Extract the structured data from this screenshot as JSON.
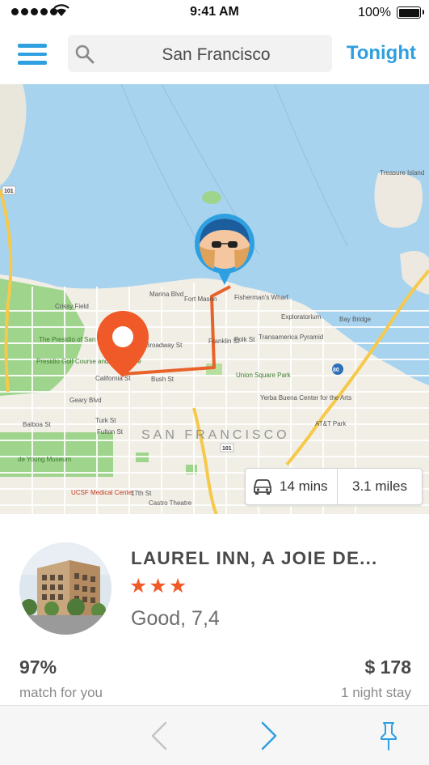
{
  "status_bar": {
    "time": "9:41 AM",
    "battery": "100%"
  },
  "topbar": {
    "search_value": "San Francisco",
    "tonight_label": "Tonight"
  },
  "map": {
    "city_label": "SAN FRANCISCO",
    "labels": [
      "Crissy Field",
      "The Presidio of San Francisco",
      "Presidio Golf Course and Clubhouse",
      "Marina Blvd",
      "Fort Mason",
      "Broadway St",
      "Franklin St",
      "Polk St",
      "California St",
      "Bush St",
      "Geary Blvd",
      "Turk St",
      "Fulton St",
      "Balboa St",
      "de Young Museum",
      "UCSF Medical Center",
      "17th St",
      "Castro Theatre",
      "Union Square Park",
      "Yerba Buena Center for the Arts",
      "Transamerica Pyramid",
      "Fisherman's Wharf",
      "Exploratorium",
      "Bay Bridge",
      "AT&T Park",
      "Treasure Island",
      "101",
      "80"
    ],
    "route": {
      "duration": "14 mins",
      "distance": "3.1 miles"
    }
  },
  "hotel": {
    "name": "LAUREL INN, A JOIE DE...",
    "stars": "★★★",
    "star_count": 3,
    "rating_text": "Good, 7,4",
    "match_value": "97%",
    "match_label": "match for you",
    "price_value": "$ 178",
    "price_label": "1 night stay"
  },
  "colors": {
    "accent": "#2e9fe0",
    "pin": "#f05a28",
    "route": "#e8622a"
  },
  "icons": [
    "signal-icon",
    "wifi-icon",
    "battery-icon",
    "menu-icon",
    "search-icon",
    "car-icon",
    "chevron-left-icon",
    "chevron-right-icon",
    "pin-icon"
  ]
}
